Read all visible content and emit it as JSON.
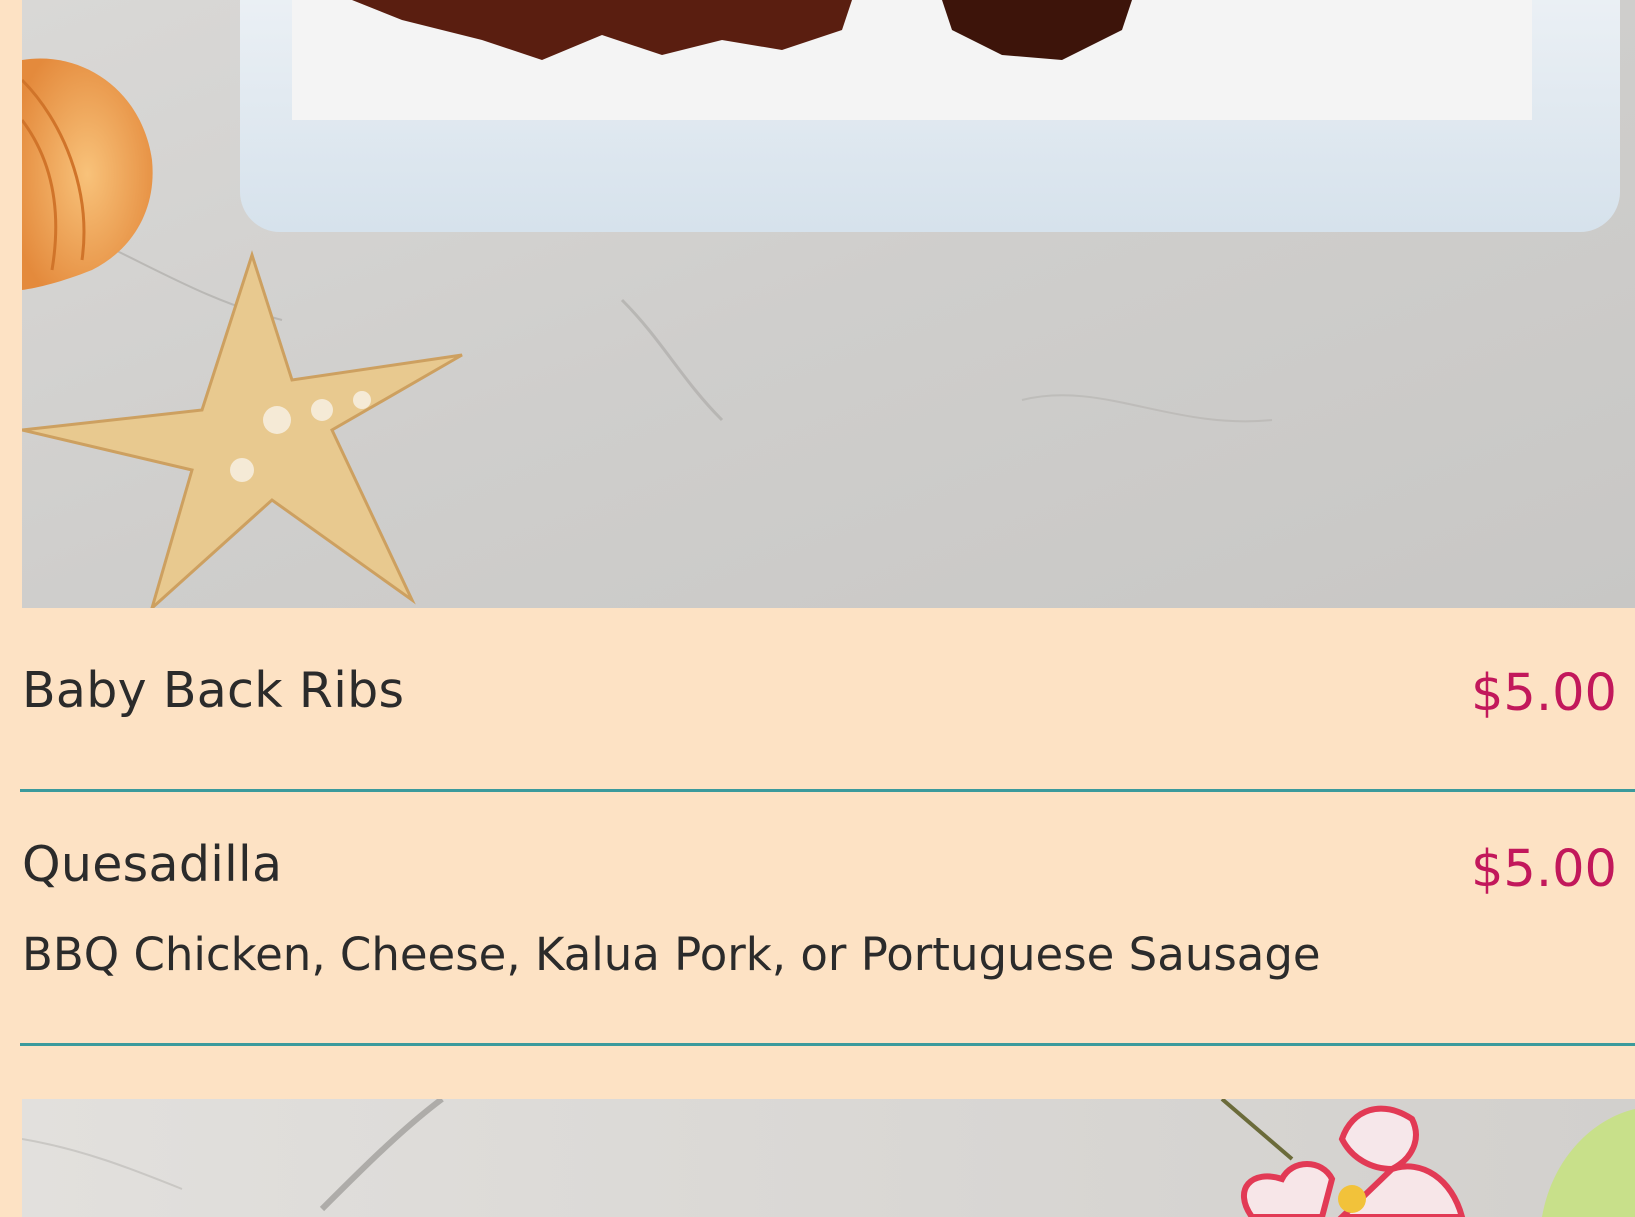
{
  "menu": {
    "items": [
      {
        "name": "Baby Back Ribs",
        "price": "$5.00",
        "description": ""
      },
      {
        "name": "Quesadilla",
        "price": "$5.00",
        "description": "BBQ Chicken, Cheese, Kalua Pork, or Portuguese Sausage"
      }
    ]
  },
  "colors": {
    "background": "#fde2c4",
    "price": "#c2185b",
    "divider": "#3b9a9c",
    "text": "#2b2b2b"
  },
  "icons": {
    "top_photo": "food-photo-icon",
    "bottom_photo": "food-photo-icon"
  }
}
